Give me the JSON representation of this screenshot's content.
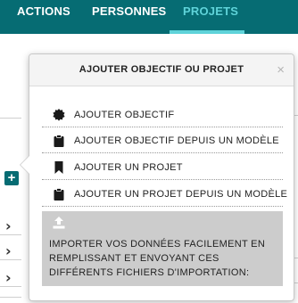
{
  "nav": {
    "tabs": [
      {
        "label": "ACTIONS",
        "active": false
      },
      {
        "label": "PERSONNES",
        "active": false
      },
      {
        "label": "PROJETS",
        "active": true
      }
    ]
  },
  "colors": {
    "nav_background": "#066c73",
    "active_tab": "#5fd3d9",
    "import_background": "#cccccc"
  },
  "popover": {
    "title": "AJOUTER OBJECTIF OU PROJET",
    "close_symbol": "×",
    "items": [
      {
        "icon": "badge-icon",
        "label": "AJOUTER OBJECTIF"
      },
      {
        "icon": "clipboard-icon",
        "label": "AJOUTER OBJECTIF DEPUIS UN MODÈLE"
      },
      {
        "icon": "bookmark-icon",
        "label": "AJOUTER UN PROJET"
      },
      {
        "icon": "clipboard-icon",
        "label": "AJOUTER UN PROJET DEPUIS UN MODÈLE"
      }
    ],
    "import": {
      "icon": "upload-icon",
      "text": "IMPORTER VOS DONNÉES FACILEMENT EN REMPLISSANT ET ENVOYANT CES DIFFÉRENTS FICHIERS D'IMPORTATION:"
    }
  },
  "page": {
    "add_button_symbol": "+",
    "row_chevron": "›"
  }
}
